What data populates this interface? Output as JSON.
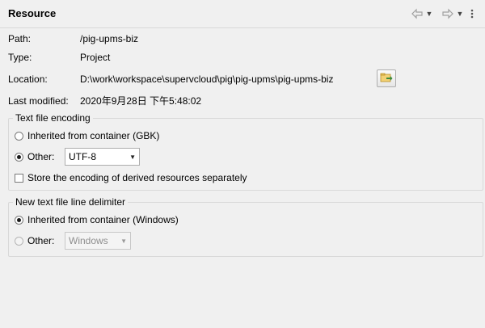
{
  "header": {
    "title": "Resource",
    "icons": [
      "back-arrow-icon",
      "dropdown-caret-icon",
      "forward-arrow-icon",
      "dropdown-caret-icon",
      "view-menu-icon"
    ]
  },
  "info": {
    "path_label": "Path:",
    "path_value": "/pig-upms-biz",
    "type_label": "Type:",
    "type_value": "Project",
    "location_label": "Location:",
    "location_value": "D:\\work\\workspace\\supervcloud\\pig\\pig-upms\\pig-upms-biz",
    "modified_label": "Last modified:",
    "modified_value": "2020年9月28日 下午5:48:02"
  },
  "encoding": {
    "legend": "Text file encoding",
    "inherited_label": "Inherited from container (GBK)",
    "other_label": "Other:",
    "other_value": "UTF-8",
    "store_label": "Store the encoding of derived resources separately"
  },
  "delimiter": {
    "legend": "New text file line delimiter",
    "inherited_label": "Inherited from container (Windows)",
    "other_label": "Other:",
    "other_value": "Windows"
  },
  "colors": {
    "background": "#f0f0f0",
    "group_border": "#d9d9d9",
    "disabled_text": "#8e8e8e"
  }
}
